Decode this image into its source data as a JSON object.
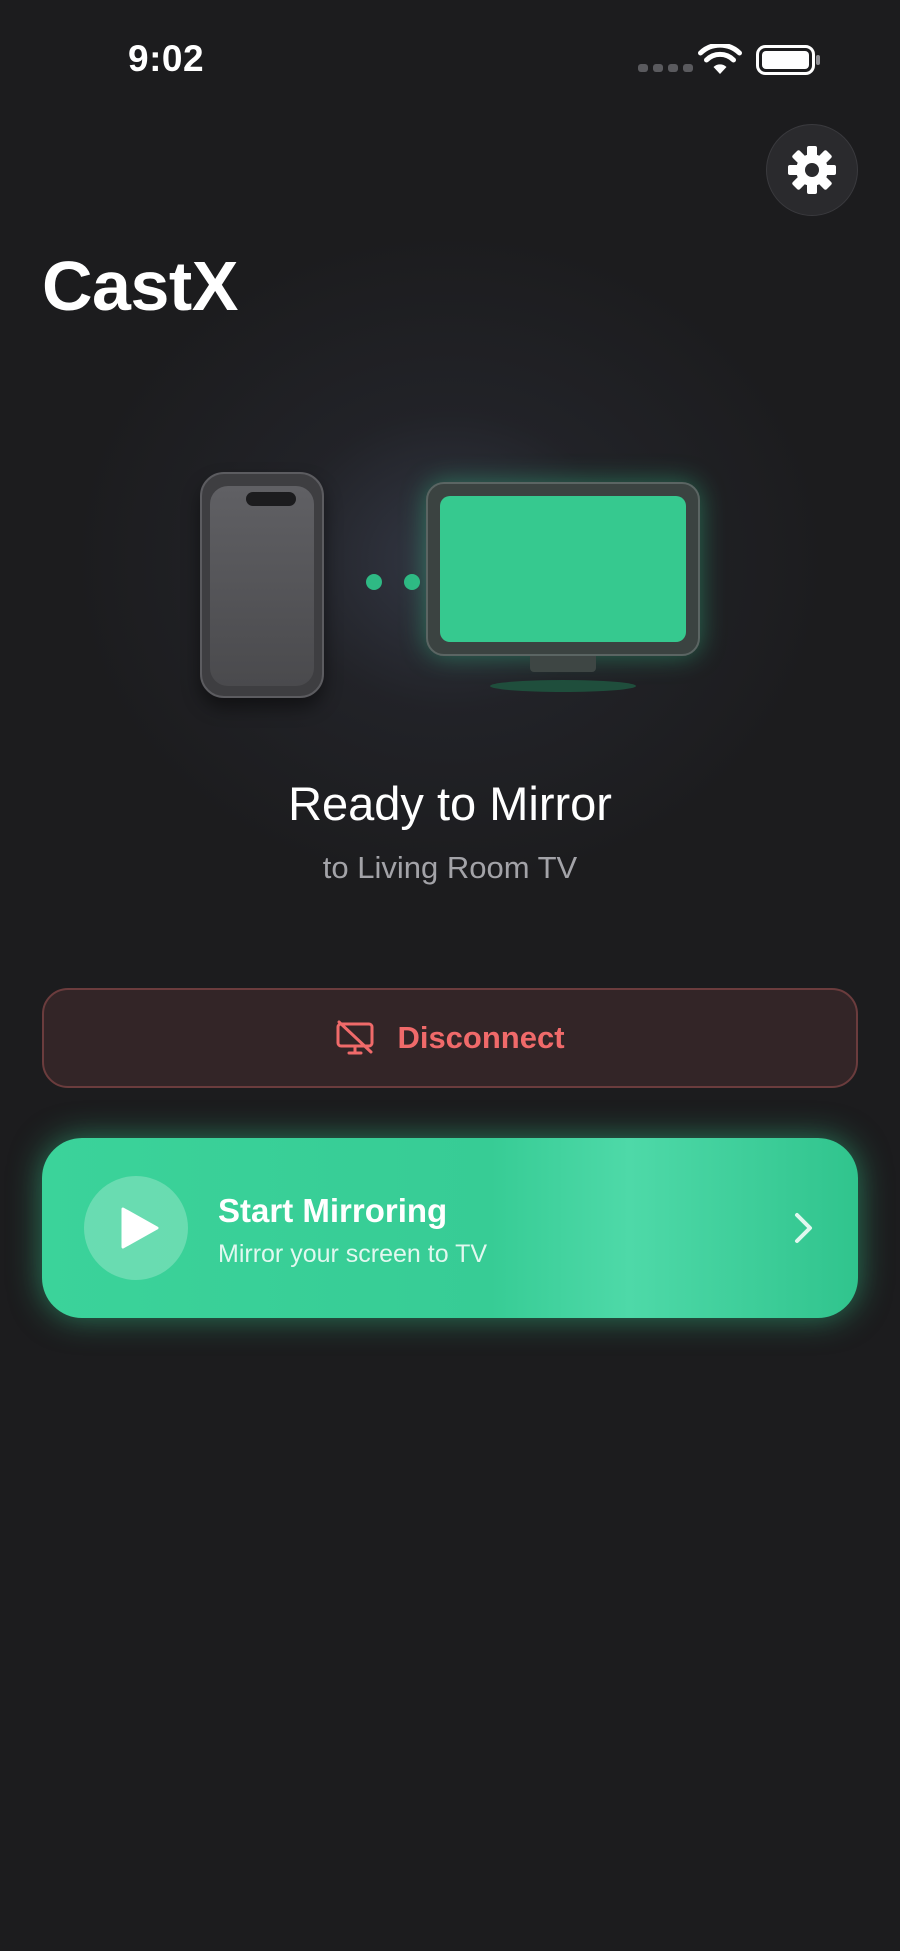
{
  "status_bar": {
    "time": "9:02",
    "icons": [
      "signal-icon",
      "wifi-icon",
      "battery-icon"
    ]
  },
  "header": {
    "title": "CastX",
    "settings_icon": "gear-icon"
  },
  "illustration": {
    "source_device": "phone-icon",
    "target_device": "tv-icon"
  },
  "status": {
    "title": "Ready to Mirror",
    "subtitle": "to Living Room TV"
  },
  "actions": {
    "disconnect_label": "Disconnect",
    "disconnect_icon": "screen-off-icon",
    "start_label": "Start Mirroring",
    "start_sublabel": "Mirror your screen to TV",
    "start_icon": "play-icon"
  },
  "colors": {
    "background": "#1c1c1e",
    "accent_green": "#36c98f",
    "danger_red": "#f06a6a"
  }
}
